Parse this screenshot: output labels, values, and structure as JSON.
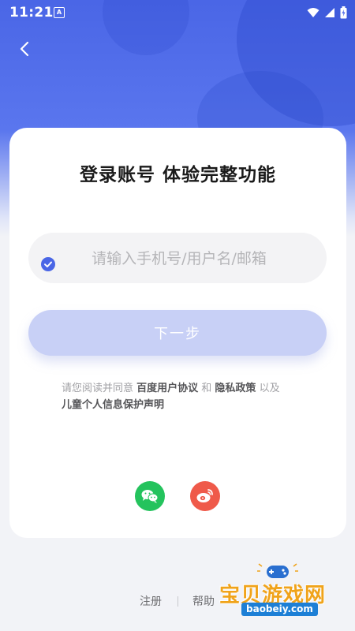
{
  "status_bar": {
    "time": "11:21",
    "app_icon_letter": "A"
  },
  "navigation": {
    "back_icon": "chevron-left-icon"
  },
  "card": {
    "title": "登录账号 体验完整功能",
    "account_input": {
      "value": "",
      "placeholder": "请输入手机号/用户名/邮箱"
    },
    "next_button_label": "下一步",
    "agreement": {
      "checked": true,
      "prefix": "请您阅读并同意 ",
      "link_terms": "百度用户协议",
      "and": " 和 ",
      "link_privacy": "隐私政策",
      "suffix": " 以及",
      "link_children": "儿童个人信息保护声明"
    },
    "social_logins": [
      {
        "name": "wechat",
        "icon": "wechat-icon",
        "color": "#24c35d"
      },
      {
        "name": "weibo",
        "icon": "weibo-icon",
        "color": "#ef5a4a"
      }
    ]
  },
  "footer": {
    "register_label": "注册",
    "help_label": "帮助"
  },
  "watermark": {
    "brand": "宝贝游戏网",
    "url": "baobeiy.com"
  },
  "colors": {
    "accent": "#4a66e6",
    "button_disabled": "#c8d0f6",
    "wechat": "#24c35d",
    "weibo": "#ef5a4a"
  }
}
